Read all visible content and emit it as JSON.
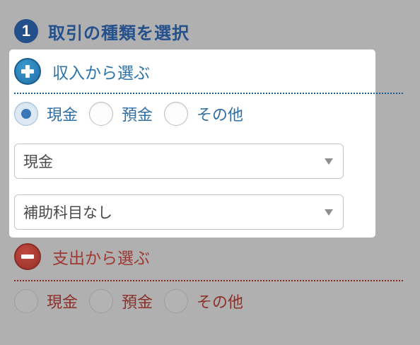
{
  "step": {
    "number": "1",
    "title": "取引の種類を選択"
  },
  "income": {
    "label": "収入から選ぶ",
    "icon": "plus-circle-icon",
    "radios": [
      {
        "label": "現金",
        "checked": true
      },
      {
        "label": "預金",
        "checked": false
      },
      {
        "label": "その他",
        "checked": false
      }
    ],
    "account_select": {
      "value": "現金"
    },
    "sub_account_select": {
      "value": "補助科目なし"
    }
  },
  "expense": {
    "label": "支出から選ぶ",
    "icon": "minus-circle-icon",
    "radios": [
      {
        "label": "現金",
        "checked": false
      },
      {
        "label": "預金",
        "checked": false
      },
      {
        "label": "その他",
        "checked": false
      }
    ]
  },
  "colors": {
    "background": "#b0b0b0",
    "step_blue": "#24508c",
    "income_blue": "#2d73a8",
    "expense_red": "#9e3a33",
    "panel": "#ffffff"
  }
}
